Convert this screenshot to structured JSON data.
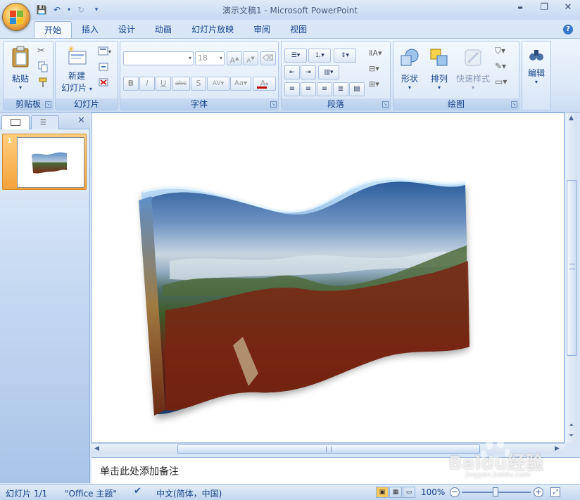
{
  "window": {
    "title": "演示文稿1 - Microsoft PowerPoint",
    "min": "▬",
    "restore": "❐",
    "close": "✕"
  },
  "tabs": [
    "开始",
    "插入",
    "设计",
    "动画",
    "幻灯片放映",
    "审阅",
    "视图"
  ],
  "ribbon": {
    "clipboard": {
      "label": "剪贴板",
      "paste": "粘贴"
    },
    "slides": {
      "label": "幻灯片",
      "new_slide_line1": "新建",
      "new_slide_line2": "幻灯片"
    },
    "font": {
      "label": "字体",
      "font_name": "",
      "font_size": "18"
    },
    "paragraph": {
      "label": "段落"
    },
    "drawing": {
      "label": "绘图",
      "shapes": "形状",
      "arrange": "排列",
      "quick_styles": "快速样式"
    },
    "editing": {
      "label": "编辑"
    }
  },
  "slides_panel": {
    "slide_number": "1"
  },
  "notes": {
    "placeholder": "单击此处添加备注"
  },
  "status": {
    "slide": "幻灯片 1/1",
    "theme": "\"Office 主题\"",
    "language": "中文(简体，中国)",
    "zoom": "100%"
  },
  "watermark": {
    "brand": "Baidu经验",
    "url": "jingyan.baidu.com"
  },
  "colors": {
    "accent": "#15428b",
    "ribbon": "#dae7f7",
    "selection": "#f5a23a"
  }
}
